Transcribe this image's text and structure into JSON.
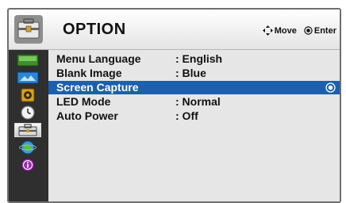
{
  "header": {
    "title": "OPTION",
    "hints": [
      {
        "icon": "move-arrows-icon",
        "label": "Move"
      },
      {
        "icon": "enter-dot-icon",
        "label": "Enter"
      }
    ]
  },
  "sidebar": {
    "items": [
      {
        "name": "picture",
        "icon": "picture-icon"
      },
      {
        "name": "screen",
        "icon": "screen-icon"
      },
      {
        "name": "audio",
        "icon": "speaker-icon"
      },
      {
        "name": "time",
        "icon": "clock-icon"
      },
      {
        "name": "option",
        "icon": "toolbox-icon",
        "active": true
      },
      {
        "name": "input",
        "icon": "globe-icon"
      },
      {
        "name": "info",
        "icon": "info-icon"
      }
    ]
  },
  "menu": {
    "items": [
      {
        "label": "Menu Language",
        "value": ": English"
      },
      {
        "label": "Blank Image",
        "value": ": Blue"
      },
      {
        "label": "Screen Capture",
        "value": "",
        "selected": true
      },
      {
        "label": "LED Mode",
        "value": ": Normal"
      },
      {
        "label": "Auto Power",
        "value": ": Off"
      }
    ]
  },
  "colors": {
    "selection": "#1c5fad",
    "sidebar": "#2f2f2f",
    "panel": "#e6e6e6"
  }
}
